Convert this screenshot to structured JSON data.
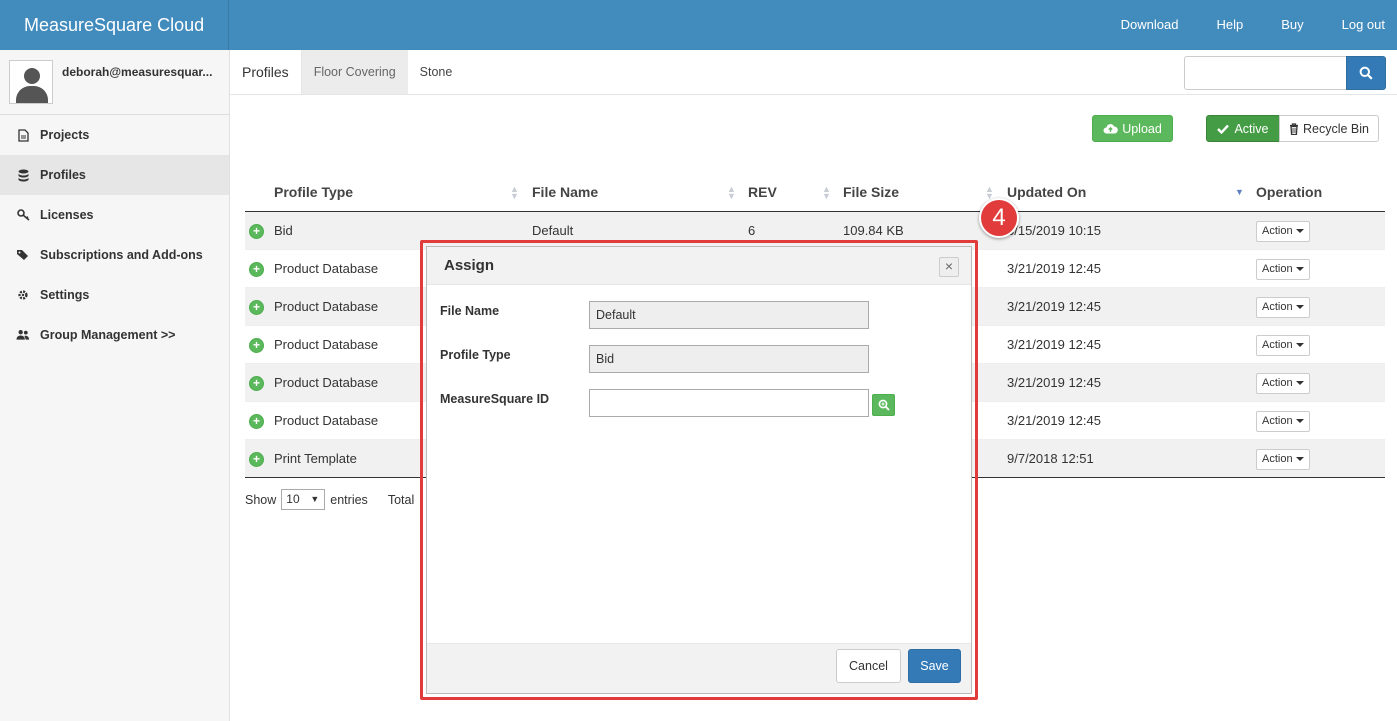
{
  "header": {
    "brand": "MeasureSquare Cloud",
    "nav": [
      "Download",
      "Help",
      "Buy",
      "Log out"
    ]
  },
  "sidebar": {
    "user": "deborah@measuresquar...",
    "items": [
      {
        "label": "Projects",
        "icon": "file-icon"
      },
      {
        "label": "Profiles",
        "icon": "database-icon",
        "active": true
      },
      {
        "label": "Licenses",
        "icon": "key-icon"
      },
      {
        "label": "Subscriptions and Add-ons",
        "icon": "tags-icon"
      },
      {
        "label": "Settings",
        "icon": "gear-icon"
      },
      {
        "label": "Group Management >>",
        "icon": "users-icon"
      }
    ]
  },
  "tabs": {
    "title": "Profiles",
    "items": [
      "Floor Covering",
      "Stone"
    ],
    "selected": "Floor Covering"
  },
  "search": {
    "placeholder": ""
  },
  "toolbar": {
    "upload": "Upload",
    "active": "Active",
    "recycle": "Recycle Bin"
  },
  "table": {
    "columns": [
      "Profile Type",
      "File Name",
      "REV",
      "File Size",
      "Updated On",
      "Operation"
    ],
    "rows": [
      {
        "type": "Bid",
        "file": "Default",
        "rev": "6",
        "size": "109.84 KB",
        "updated": "3/15/2019 10:15",
        "op": "Action"
      },
      {
        "type": "Product Database",
        "file": "",
        "rev": "",
        "size": "",
        "updated": "3/21/2019 12:45",
        "op": "Action"
      },
      {
        "type": "Product Database",
        "file": "",
        "rev": "",
        "size": "",
        "updated": "3/21/2019 12:45",
        "op": "Action"
      },
      {
        "type": "Product Database",
        "file": "",
        "rev": "",
        "size": "",
        "updated": "3/21/2019 12:45",
        "op": "Action"
      },
      {
        "type": "Product Database",
        "file": "",
        "rev": "",
        "size": "",
        "updated": "3/21/2019 12:45",
        "op": "Action"
      },
      {
        "type": "Product Database",
        "file": "",
        "rev": "",
        "size": "",
        "updated": "3/21/2019 12:45",
        "op": "Action"
      },
      {
        "type": "Print Template",
        "file": "",
        "rev": "",
        "size": "",
        "updated": "9/7/2018 12:51",
        "op": "Action"
      }
    ]
  },
  "footer": {
    "show": "Show",
    "entries_value": "10",
    "entries": "entries",
    "total": "Total"
  },
  "step_badge": "4",
  "modal": {
    "title": "Assign",
    "fields": {
      "file_name_label": "File Name",
      "file_name_value": "Default",
      "profile_type_label": "Profile Type",
      "profile_type_value": "Bid",
      "msid_label": "MeasureSquare ID",
      "msid_value": ""
    },
    "cancel": "Cancel",
    "save": "Save"
  },
  "colors": {
    "header": "#428bbd",
    "primary": "#337ab7",
    "success": "#5cb85c",
    "highlight": "#e23b3b"
  }
}
